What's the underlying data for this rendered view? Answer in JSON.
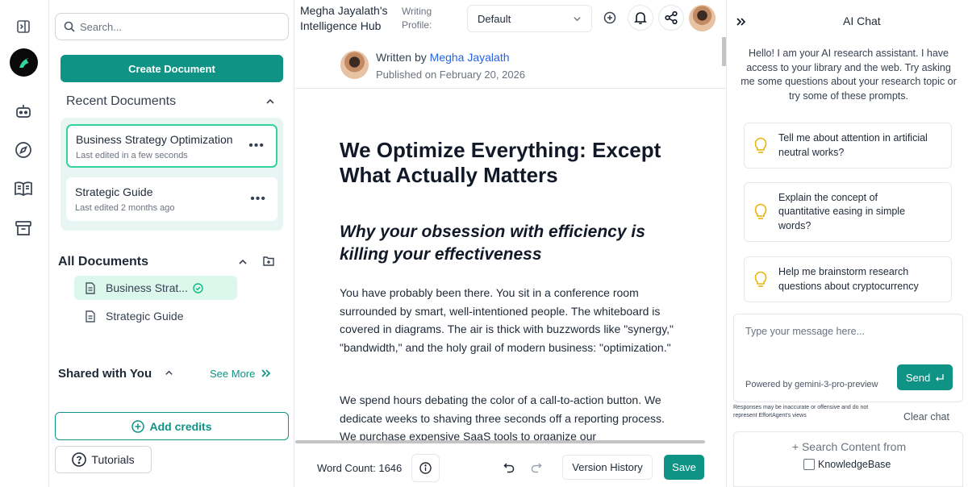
{
  "colors": {
    "accent": "#0e9384",
    "active_border": "#34d399",
    "recent_bg": "#e7f5f3",
    "active_item_bg": "#dcf7ec",
    "link": "#2563eb"
  },
  "rail": {
    "icons": [
      "sidebar-toggle-icon",
      "logo-bird-icon",
      "bot-icon",
      "compass-icon",
      "book-open-icon",
      "archive-icon"
    ]
  },
  "sidebar": {
    "search_placeholder": "Search...",
    "create_label": "Create Document",
    "recent": {
      "title": "Recent Documents",
      "items": [
        {
          "title": "Business Strategy Optimization",
          "subtitle": "Last edited in a few seconds",
          "active": true
        },
        {
          "title": "Strategic Guide",
          "subtitle": "Last edited 2 months ago",
          "active": false
        }
      ]
    },
    "all": {
      "title": "All Documents",
      "items": [
        {
          "label": "Business Strat...",
          "active": true
        },
        {
          "label": "Strategic Guide",
          "active": false
        }
      ]
    },
    "shared": {
      "title": "Shared with You",
      "see_more": "See More"
    },
    "credits_label": "Add credits",
    "tutorials_label": "Tutorials"
  },
  "header": {
    "hub_title": "Megha Jayalath's Intelligence Hub",
    "profile_label": "Writing Profile:",
    "profile_value": "Default"
  },
  "article": {
    "written_by": "Written by",
    "author": "Megha Jayalath",
    "published": "Published on February 20, 2026",
    "title": "We Optimize Everything: Except What Actually Matters",
    "subtitle": "Why your obsession with efficiency is killing your effectiveness",
    "paragraphs": [
      "You have probably been there. You sit in a conference room surrounded by smart, well-intentioned people. The whiteboard is covered in diagrams. The air is thick with buzzwords like \"synergy,\" \"bandwidth,\" and the holy grail of modern business: \"optimization.\"",
      "We spend hours debating the color of a call-to-action button. We dedicate weeks to shaving three seconds off a reporting process. We purchase expensive SaaS tools to organize our"
    ]
  },
  "footer": {
    "word_count": "Word Count: 1646",
    "version_history": "Version History",
    "save": "Save"
  },
  "chat": {
    "title": "AI Chat",
    "greeting": "Hello! I am your AI research assistant. I have access to your library and the web. Try asking me some questions about your research topic or try some of these prompts.",
    "prompts": [
      "Tell me about attention in artificial neutral works?",
      "Explain the concept of quantitative easing in simple words?",
      "Help me brainstorm research questions about cryptocurrency"
    ],
    "input_placeholder": "Type your message here...",
    "powered_by": "Powered by gemini-3-pro-preview",
    "send": "Send",
    "disclaimer": "Responses may be inaccurate or offensive and do not represent EffortAgent's views",
    "clear": "Clear chat",
    "search_from": "+ Search Content from",
    "kb_label": "KnowledgeBase"
  }
}
